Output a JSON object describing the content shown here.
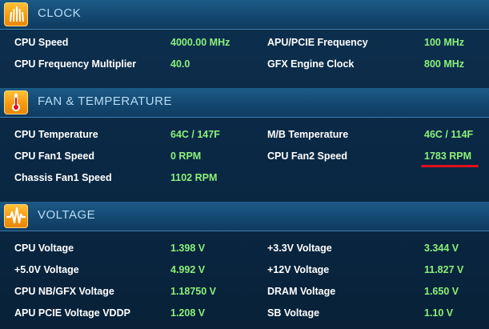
{
  "clock": {
    "title": "CLOCK",
    "rows": [
      {
        "label": "CPU Speed",
        "value": "4000.00 MHz"
      },
      {
        "label": "APU/PCIE Frequency",
        "value": "100 MHz"
      },
      {
        "label": "CPU Frequency Multiplier",
        "value": "40.0"
      },
      {
        "label": "GFX Engine Clock",
        "value": "800 MHz"
      }
    ]
  },
  "fan": {
    "title": "FAN & TEMPERATURE",
    "rows": [
      {
        "label": "CPU Temperature",
        "value": "64C / 147F"
      },
      {
        "label": "M/B Temperature",
        "value": "46C / 114F"
      },
      {
        "label": "CPU Fan1 Speed",
        "value": "0 RPM"
      },
      {
        "label": "CPU Fan2 Speed",
        "value": "1783 RPM"
      },
      {
        "label": "Chassis Fan1 Speed",
        "value": "1102 RPM"
      }
    ]
  },
  "voltage": {
    "title": "VOLTAGE",
    "rows": [
      {
        "label": "CPU Voltage",
        "value": "1.398 V"
      },
      {
        "label": "+3.3V Voltage",
        "value": "3.344 V"
      },
      {
        "label": "+5.0V Voltage",
        "value": "4.992 V"
      },
      {
        "label": "+12V Voltage",
        "value": "11.827 V"
      },
      {
        "label": "CPU NB/GFX Voltage",
        "value": "1.18750 V"
      },
      {
        "label": "DRAM Voltage",
        "value": "1.650 V"
      },
      {
        "label": "APU PCIE Voltage VDDP",
        "value": "1.208 V"
      },
      {
        "label": "SB Voltage",
        "value": "1.10 V"
      }
    ]
  },
  "colors": {
    "label": "#ffffff",
    "value": "#8df07a",
    "header_title": "#b9dbf6",
    "icon_orange": "#f59a12",
    "highlight_underline": "#e0101c"
  },
  "icons": {
    "clock": "bars-icon",
    "fan": "thermometer-icon",
    "voltage": "waveform-icon"
  }
}
